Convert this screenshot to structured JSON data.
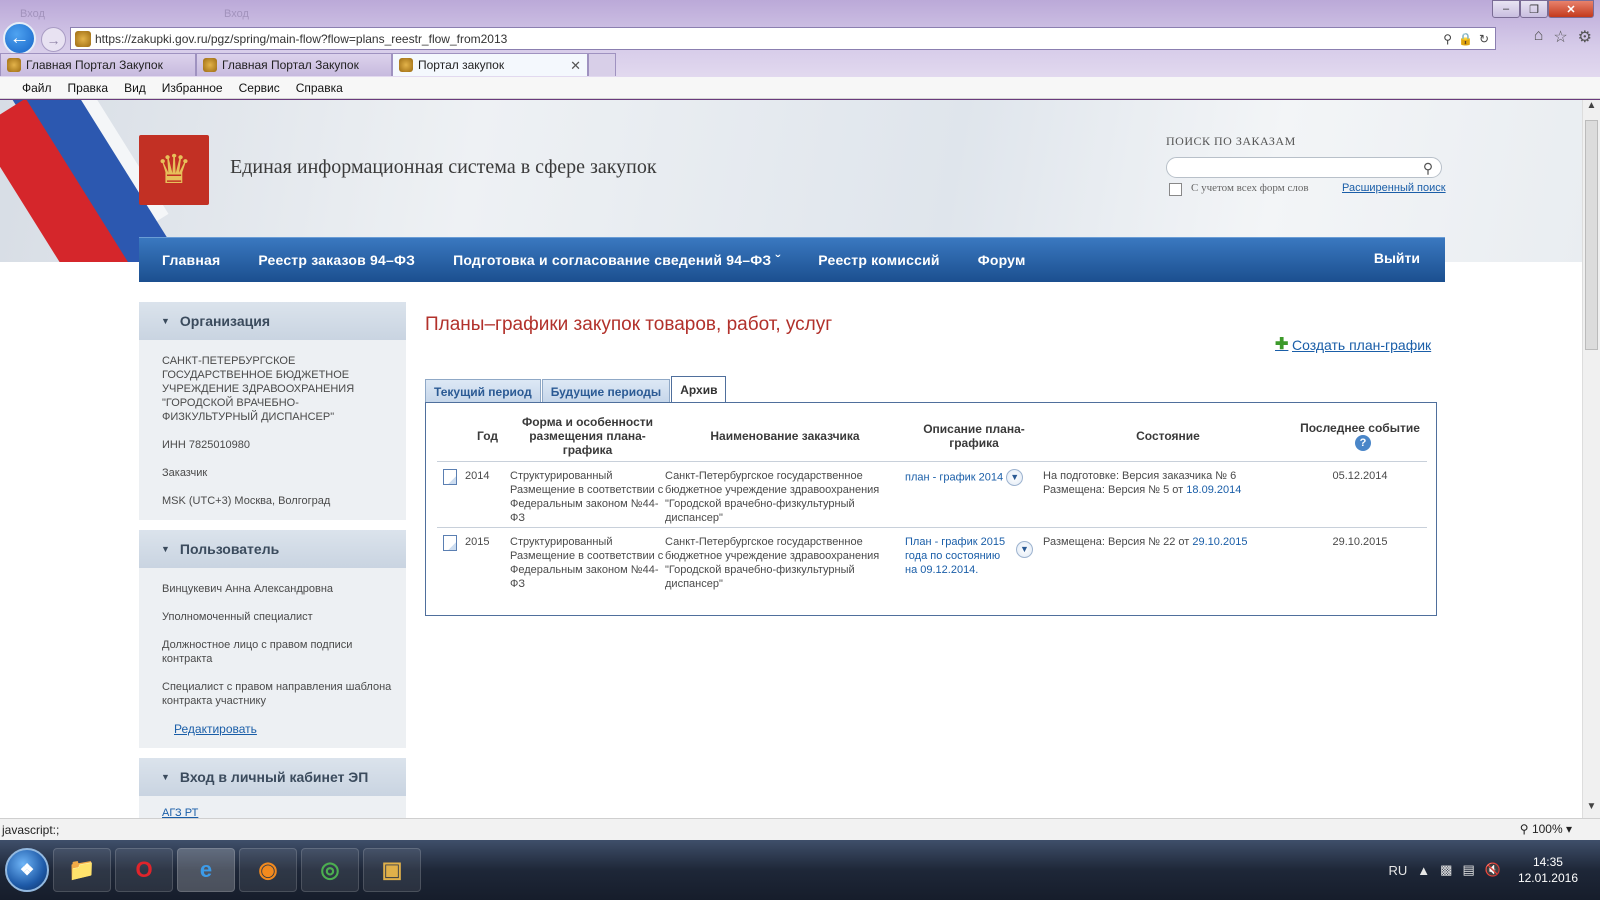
{
  "browser": {
    "ghost_tabs": [
      "Вход",
      "Вход",
      "",
      "",
      "",
      ""
    ],
    "window_controls": [
      "–",
      "❐",
      "✕"
    ],
    "url": "https://zakupki.gov.ru/pgz/spring/main-flow?flow=plans_reestr_flow_from2013",
    "tabs": [
      {
        "label": "Главная Портал Закупок",
        "active": false
      },
      {
        "label": "Главная Портал Закупок",
        "active": false
      },
      {
        "label": "Портал закупок",
        "active": true
      }
    ],
    "menu": [
      "Файл",
      "Правка",
      "Вид",
      "Избранное",
      "Сервис",
      "Справка"
    ],
    "status_text": "javascript:;",
    "zoom": "100%"
  },
  "header": {
    "site_title": "Единая информационная система в сфере закупок",
    "search_label": "ПОИСК ПО ЗАКАЗАМ",
    "search_placeholder": "",
    "all_forms_label": "С учетом всех форм слов",
    "advanced_search": "Расширенный поиск"
  },
  "nav": {
    "items": [
      "Главная",
      "Реестр заказов 94–ФЗ",
      "Подготовка и согласование сведений 94–ФЗ  ˇ",
      "Реестр комиссий",
      "Форум"
    ],
    "logout": "Выйти"
  },
  "sidebar": {
    "org_title": "Организация",
    "org_name": "САНКТ-ПЕТЕРБУРГСКОЕ ГОСУДАРСТВЕННОЕ БЮДЖЕТНОЕ УЧРЕЖДЕНИЕ ЗДРАВООХРАНЕНИЯ \"ГОРОДСКОЙ ВРАЧЕБНО-ФИЗКУЛЬТУРНЫЙ ДИСПАНСЕР\"",
    "inn": "ИНН 7825010980",
    "role": "Заказчик",
    "timezone": "MSK (UTC+3) Москва, Волгоград",
    "user_title": "Пользователь",
    "user_name": "Винцукевич Анна Александровна",
    "user_roles": [
      "Уполномоченный специалист",
      "Должностное лицо с правом подписи контракта",
      "Специалист с правом направления шаблона контракта участнику"
    ],
    "edit_link": "Редактировать",
    "ep_title": "Вход в личный кабинет ЭП",
    "ep_item": "АГЗ РТ"
  },
  "main": {
    "title": "Планы–графики закупок товаров, работ, услуг",
    "create_link": "Создать план-график",
    "tabs": [
      {
        "label": "Текущий период",
        "active": false
      },
      {
        "label": "Будущие периоды",
        "active": false
      },
      {
        "label": "Архив",
        "active": true
      }
    ],
    "columns": [
      "Год",
      "Форма и особенности размещения плана-графика",
      "Наименование заказчика",
      "Описание плана-графика",
      "Состояние",
      "Последнее событие"
    ],
    "rows": [
      {
        "year": "2014",
        "form": "Структурированный Размещение в соответствии с Федеральным законом №44-ФЗ",
        "customer": "Санкт-Петербургское государственное бюджетное учреждение здравоохранения \"Городской врачебно-физкультурный диспансер\"",
        "description": "план - график 2014",
        "state_line1": "На подготовке:  Версия заказчика №  6",
        "state_line2_prefix": "Размещена: Версия №  5 от ",
        "state_line2_date": "18.09.2014",
        "last_event": "05.12.2014"
      },
      {
        "year": "2015",
        "form": "Структурированный Размещение в соответствии с Федеральным законом №44-ФЗ",
        "customer": "Санкт-Петербургское государственное бюджетное учреждение здравоохранения \"Городской врачебно-физкультурный диспансер\"",
        "description": "План - график 2015 года по состоянию на 09.12.2014.",
        "state_line1_prefix": "Размещена: Версия №  22 от ",
        "state_line1_date": "29.10.2015",
        "last_event": "29.10.2015"
      }
    ]
  },
  "taskbar": {
    "lang": "RU",
    "time": "14:35",
    "date": "12.01.2016"
  },
  "colors": {
    "nav_blue": "#1b4f8f",
    "title_red": "#b2312b",
    "link_blue": "#1a5ea8"
  }
}
